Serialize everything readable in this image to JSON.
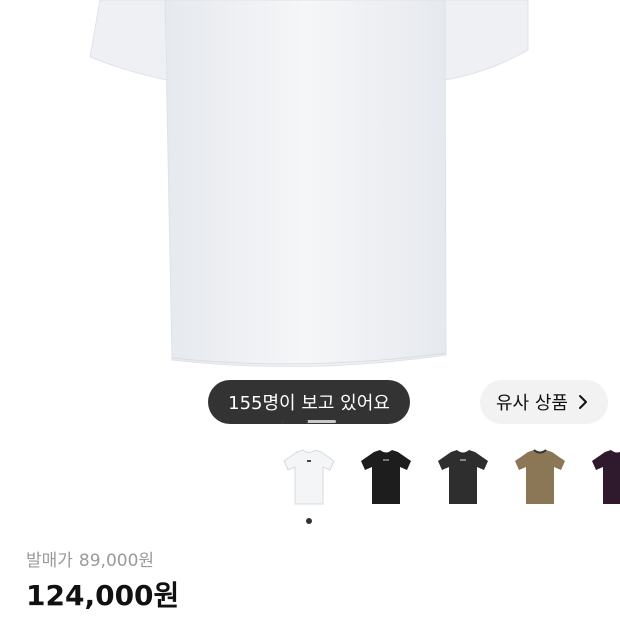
{
  "product": {
    "viewers_badge": "155명이 보고 있어요",
    "similar_button_label": "유사 상품",
    "original_price_label": "발매가",
    "original_price": "89,000원",
    "price": "124,000원"
  },
  "gallery": {
    "page_count": 2,
    "active_page": 1,
    "thumbnails": [
      {
        "name": "white",
        "color": "#f4f5f7"
      },
      {
        "name": "black",
        "color": "#1d1d1d"
      },
      {
        "name": "charcoal",
        "color": "#2e2e2e"
      },
      {
        "name": "khaki",
        "color": "#8b7656"
      },
      {
        "name": "purple",
        "color": "#2e1a2c"
      }
    ]
  },
  "colors": {
    "badge_bg": "#222222",
    "pill_bg": "#f2f2f2",
    "muted_text": "#9a9a9a"
  }
}
